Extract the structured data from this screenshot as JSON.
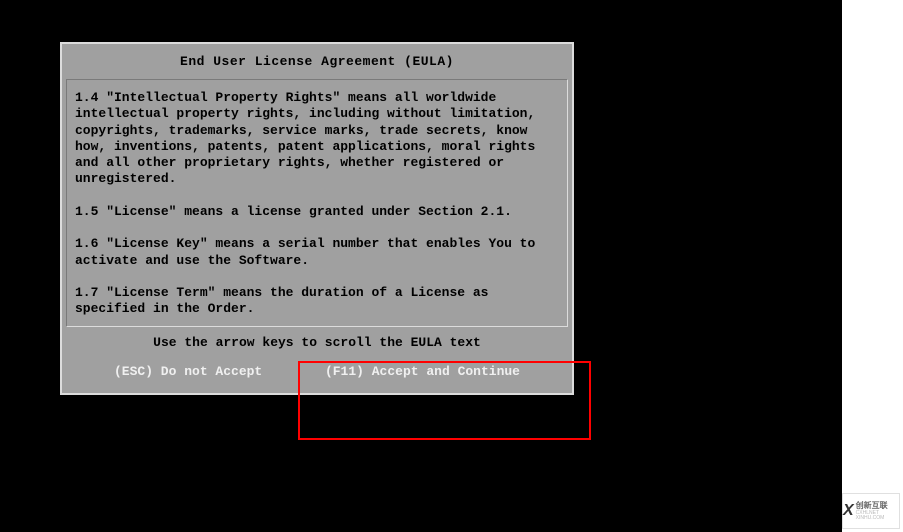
{
  "dialog": {
    "title": "End User License Agreement (EULA)",
    "body": "1.4 \"Intellectual Property Rights\" means all worldwide\nintellectual property rights, including without limitation,\ncopyrights, trademarks, service marks, trade secrets, know\nhow, inventions, patents, patent applications, moral rights\nand all other proprietary rights, whether registered or\nunregistered.\n\n1.5 \"License\" means a license granted under Section 2.1.\n\n1.6 \"License Key\" means a serial number that enables You to\nactivate and use the Software.\n\n1.7 \"License Term\" means the duration of a License as\nspecified in the Order.",
    "scroll_hint": "Use the arrow keys to scroll the EULA text",
    "buttons": {
      "cancel": "(ESC) Do not Accept",
      "accept": "(F11) Accept and Continue"
    }
  },
  "watermark": {
    "brand": "创新互联",
    "sub": "CXHLNET XINHU.COM"
  }
}
